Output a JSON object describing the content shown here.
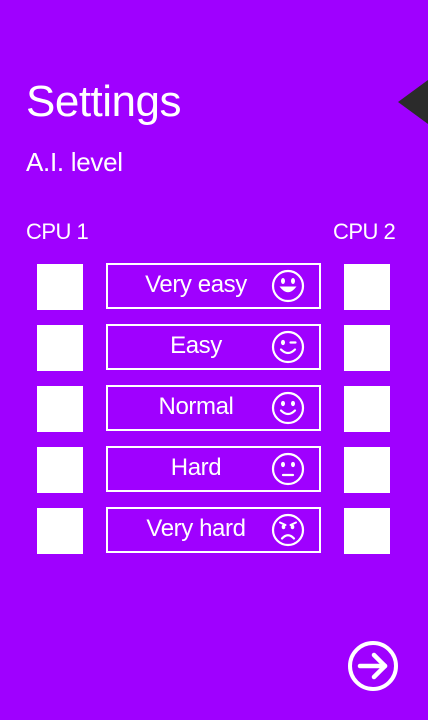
{
  "header": {
    "title": "Settings",
    "subtitle": "A.I. level"
  },
  "columns": {
    "left_label": "CPU 1",
    "right_label": "CPU 2"
  },
  "levels": [
    {
      "label": "Very easy",
      "icon": "grinning-face-icon"
    },
    {
      "label": "Easy",
      "icon": "winking-face-icon"
    },
    {
      "label": "Normal",
      "icon": "smiling-face-icon"
    },
    {
      "label": "Hard",
      "icon": "neutral-face-icon"
    },
    {
      "label": "Very hard",
      "icon": "angry-face-icon"
    }
  ],
  "colors": {
    "background": "#9f00ff",
    "foreground": "#ffffff",
    "back_arrow": "#2b2b2b"
  },
  "navigation": {
    "back_icon": "back-arrow-icon",
    "next_icon": "arrow-right-circle-icon"
  }
}
